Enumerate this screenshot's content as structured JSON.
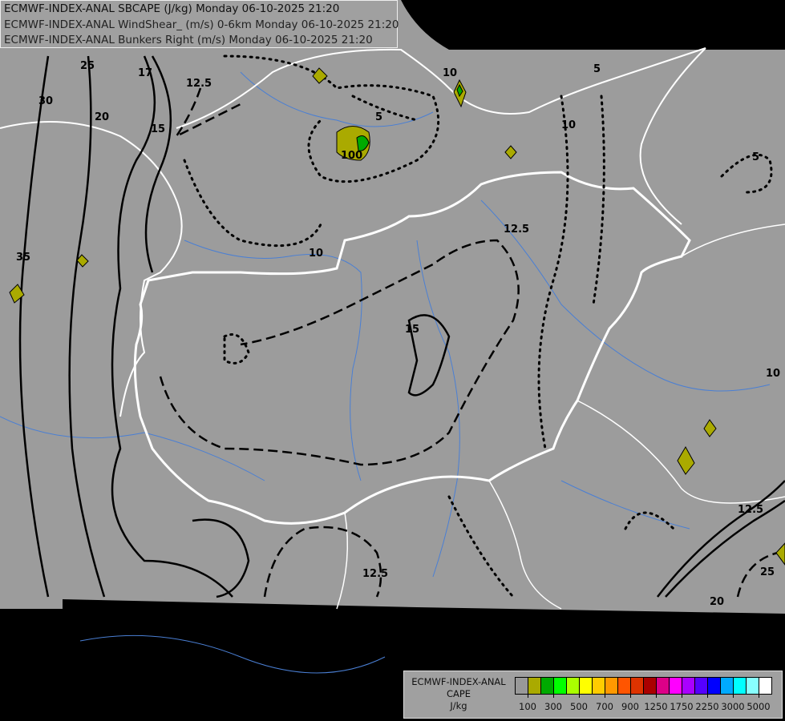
{
  "titles": [
    "ECMWF-INDEX-ANAL SBCAPE (J/kg) Monday 06-10-2025 21:20",
    "ECMWF-INDEX-ANAL WindShear_ (m/s) 0-6km Monday 06-10-2025 21:20",
    "ECMWF-INDEX-ANAL Bunkers Right (m/s) Monday 06-10-2025 21:20"
  ],
  "legend": {
    "title_lines": [
      "ECMWF-INDEX-ANAL",
      "CAPE",
      "J/kg"
    ],
    "colors": [
      "#999999",
      "#aaaa00",
      "#00aa00",
      "#00ff00",
      "#aaff00",
      "#ffff00",
      "#ffcc00",
      "#ff9900",
      "#ff5500",
      "#dd3300",
      "#aa0000",
      "#dd0088",
      "#ff00ff",
      "#aa00ff",
      "#5500ff",
      "#0000ff",
      "#00aaff",
      "#00ffff",
      "#88ffff",
      "#ffffff"
    ],
    "tick_labels": [
      "100",
      "300",
      "500",
      "700",
      "900",
      "1250",
      "1750",
      "2250",
      "3000",
      "5000"
    ]
  },
  "contour_labels": {
    "shear": [
      "25",
      "30",
      "20",
      "17",
      "15",
      "35",
      "20",
      "25"
    ],
    "bunkers": [
      "12.5",
      "5",
      "10",
      "5",
      "10",
      "12.5",
      "15",
      "10",
      "5",
      "10",
      "12.5",
      "12.5"
    ],
    "cape": [
      "100"
    ]
  },
  "colors": {
    "background": "#000000",
    "domain": "#9c9c9c",
    "borders": "#ffffff",
    "rivers": "#4a7fd4"
  }
}
